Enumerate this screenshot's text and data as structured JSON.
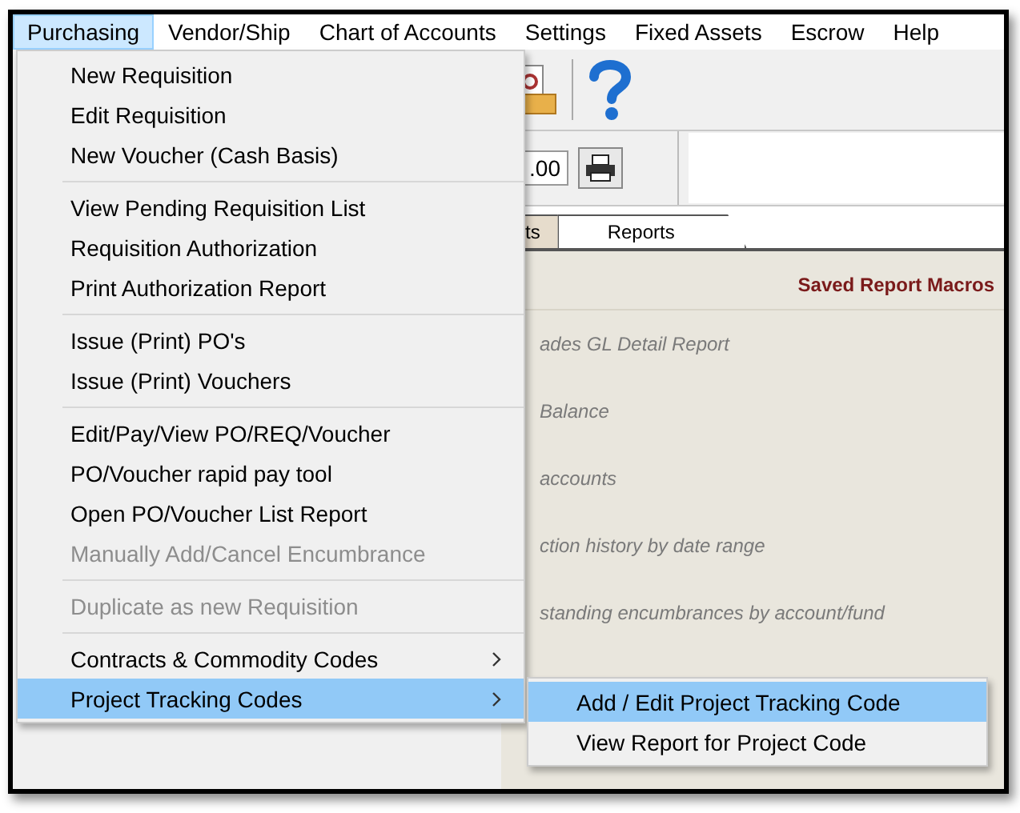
{
  "menu_bar": [
    {
      "label": "Purchasing",
      "selected": true
    },
    {
      "label": "Vendor/Ship",
      "selected": false
    },
    {
      "label": "Chart of Accounts",
      "selected": false
    },
    {
      "label": "Settings",
      "selected": false
    },
    {
      "label": "Fixed Assets",
      "selected": false
    },
    {
      "label": "Escrow",
      "selected": false
    },
    {
      "label": "Help",
      "selected": false
    }
  ],
  "purchasing_menu": [
    [
      {
        "label": "New Requisition",
        "disabled": false,
        "submenu": false,
        "selected": false
      },
      {
        "label": "Edit Requisition",
        "disabled": false,
        "submenu": false,
        "selected": false
      },
      {
        "label": "New Voucher (Cash Basis)",
        "disabled": false,
        "submenu": false,
        "selected": false
      }
    ],
    [
      {
        "label": "View Pending Requisition List",
        "disabled": false,
        "submenu": false,
        "selected": false
      },
      {
        "label": "Requisition  Authorization",
        "disabled": false,
        "submenu": false,
        "selected": false
      },
      {
        "label": "Print Authorization Report",
        "disabled": false,
        "submenu": false,
        "selected": false
      }
    ],
    [
      {
        "label": "Issue (Print) PO's",
        "disabled": false,
        "submenu": false,
        "selected": false
      },
      {
        "label": "Issue (Print) Vouchers",
        "disabled": false,
        "submenu": false,
        "selected": false
      }
    ],
    [
      {
        "label": "Edit/Pay/View  PO/REQ/Voucher",
        "disabled": false,
        "submenu": false,
        "selected": false
      },
      {
        "label": "PO/Voucher  rapid pay tool",
        "disabled": false,
        "submenu": false,
        "selected": false
      },
      {
        "label": "Open PO/Voucher List Report",
        "disabled": false,
        "submenu": false,
        "selected": false
      },
      {
        "label": "Manually Add/Cancel Encumbrance",
        "disabled": true,
        "submenu": false,
        "selected": false
      }
    ],
    [
      {
        "label": "Duplicate as new Requisition",
        "disabled": true,
        "submenu": false,
        "selected": false
      }
    ],
    [
      {
        "label": "Contracts & Commodity Codes",
        "disabled": false,
        "submenu": true,
        "selected": false
      },
      {
        "label": "Project Tracking Codes",
        "disabled": false,
        "submenu": true,
        "selected": true
      }
    ]
  ],
  "project_tracking_submenu": [
    {
      "label": "Add / Edit Project Tracking Code",
      "selected": true
    },
    {
      "label": "View Report for Project Code",
      "selected": false
    }
  ],
  "toolbar": {
    "amount_field": ".00"
  },
  "tabs": [
    {
      "label": "ts",
      "selected": false
    },
    {
      "label": "Reports",
      "selected": true
    }
  ],
  "reports_panel": {
    "macros_link": "Saved Report Macros",
    "descriptions": [
      "ades GL Detail Report",
      "Balance",
      "accounts",
      "ction history by date range",
      "standing encumbrances by account/fund"
    ]
  }
}
